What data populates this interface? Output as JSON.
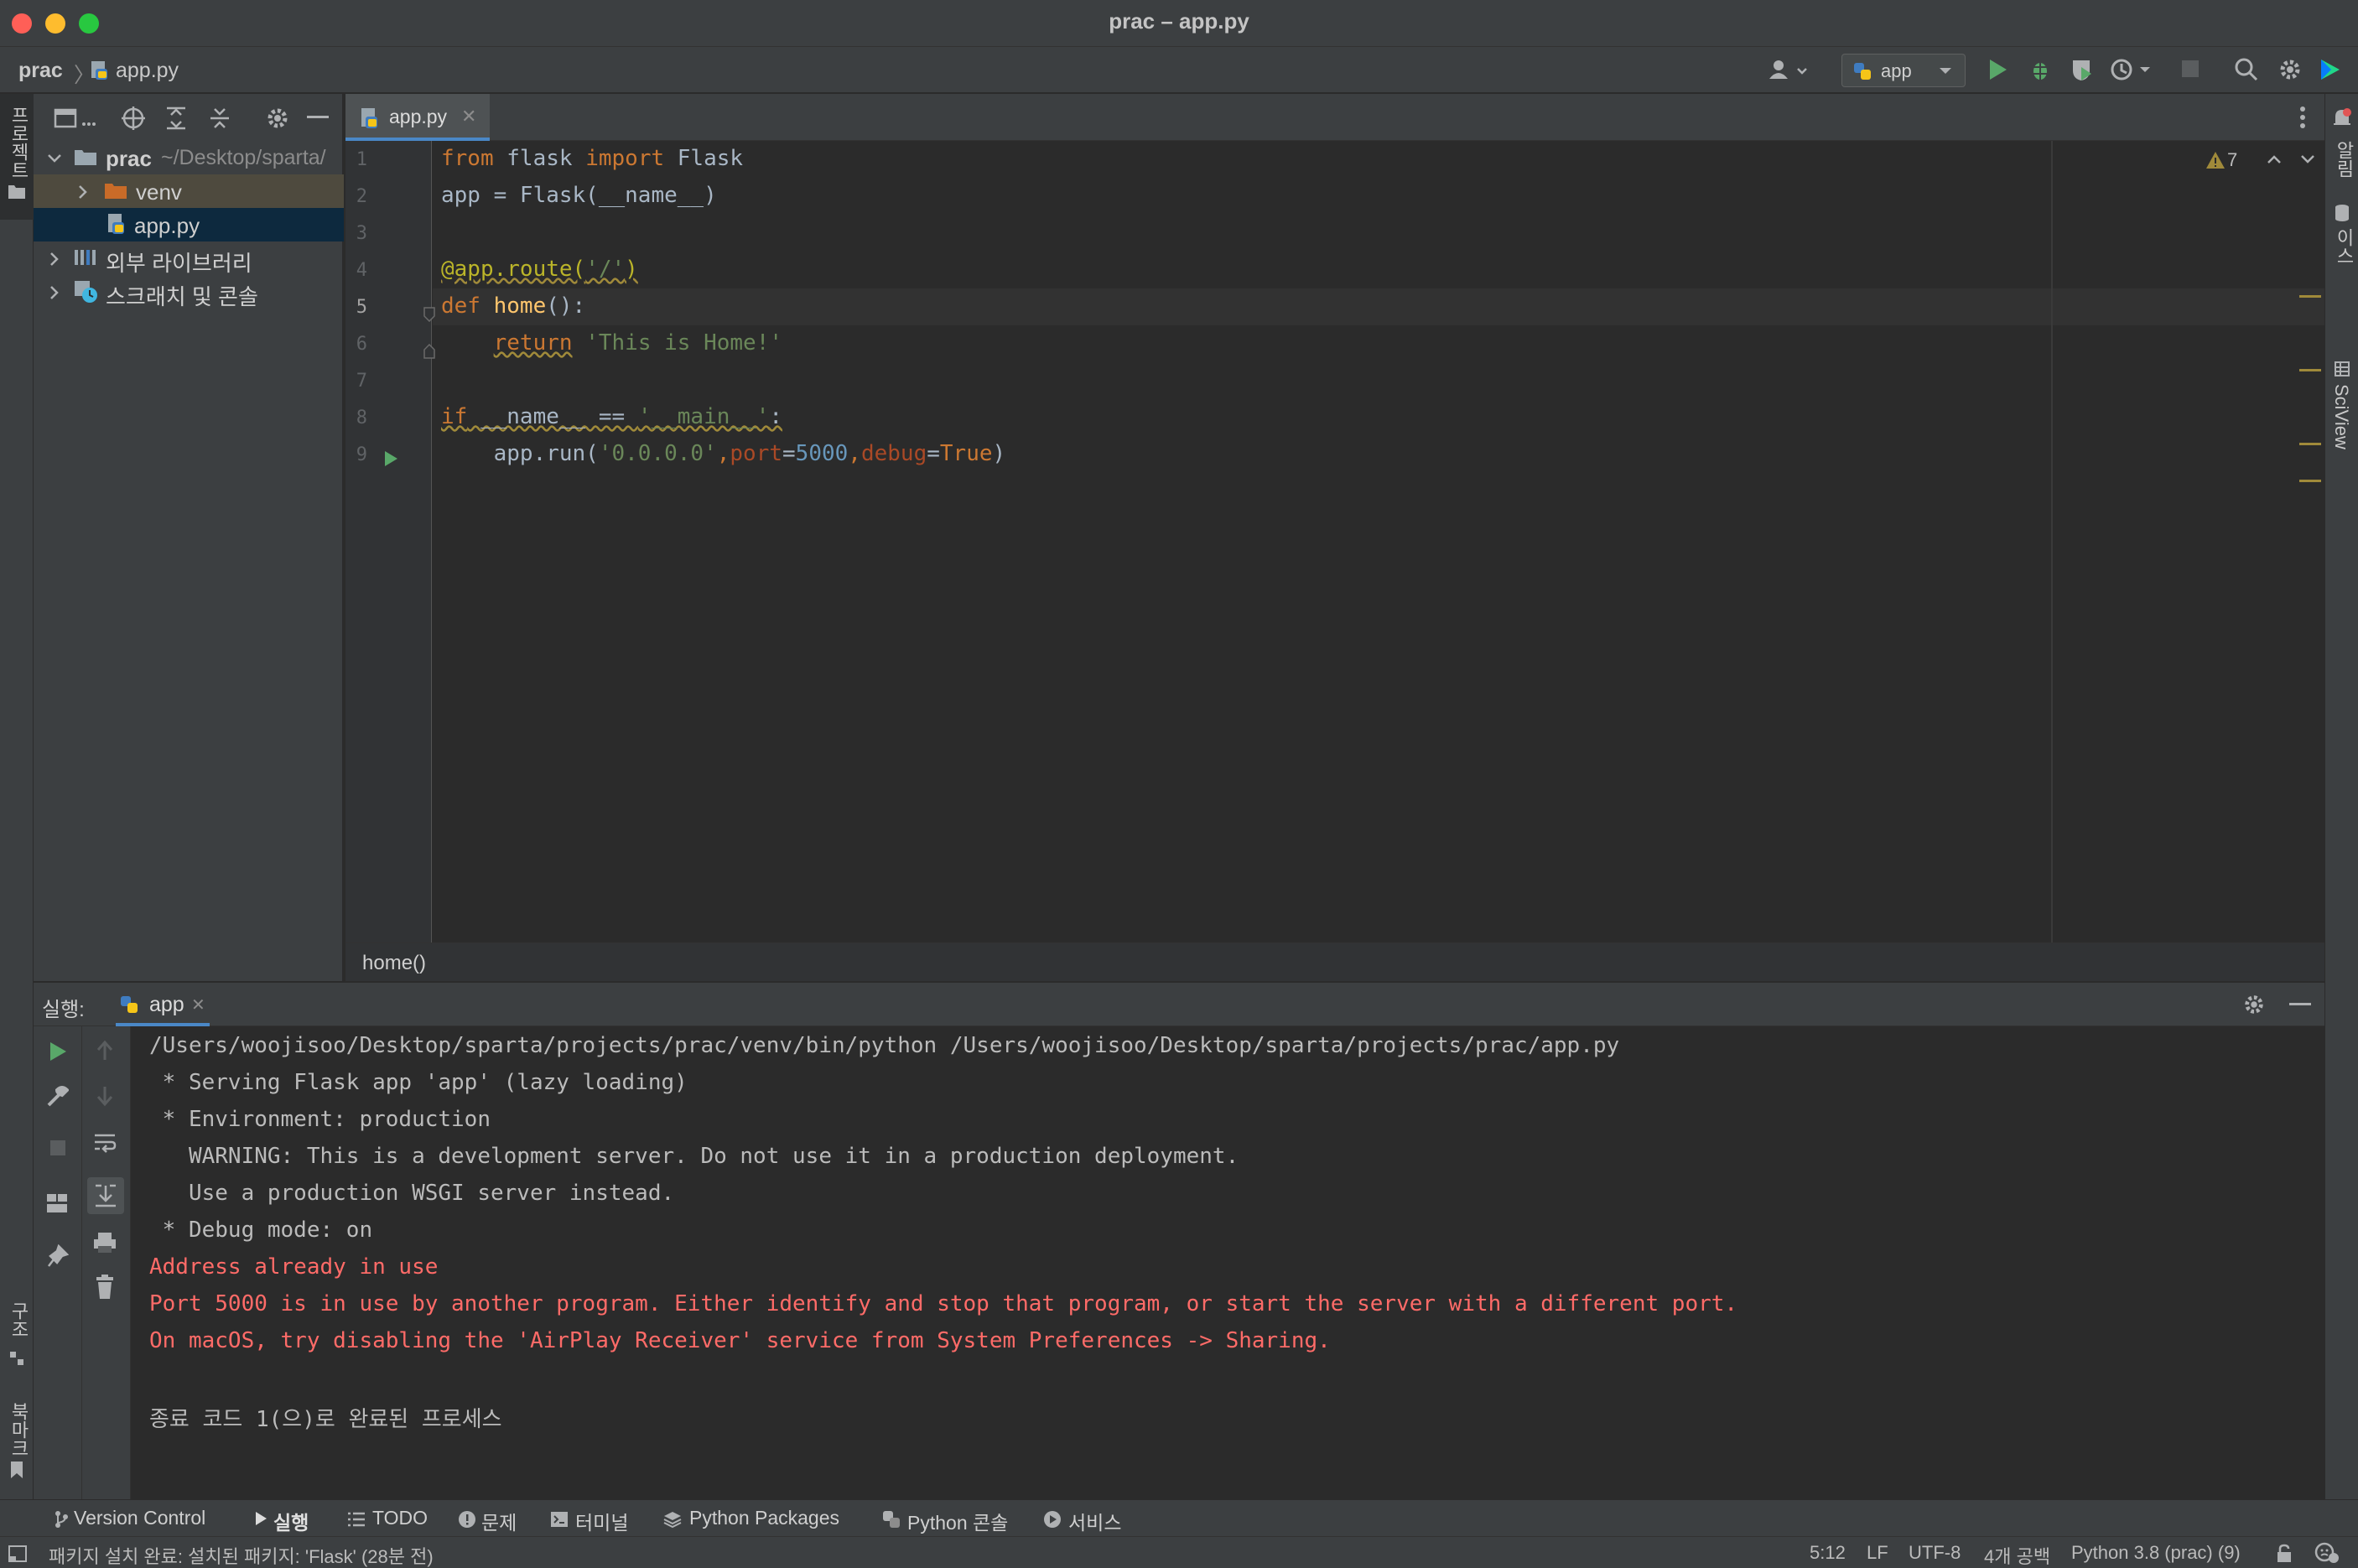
{
  "window": {
    "title": "prac – app.py"
  },
  "navbar": {
    "project": "prac",
    "file": "app.py",
    "run_config": "app"
  },
  "left_strip": {
    "project_label": "프로젝트",
    "structure_label": "구조",
    "bookmarks_label": "북마크"
  },
  "right_strip": {
    "notifications_label": "알림",
    "database_label": "데이터베이스",
    "sciview_label": "SciView"
  },
  "project_tree": {
    "root_name": "prac",
    "root_path": "~/Desktop/sparta/",
    "items": [
      {
        "label": "venv"
      },
      {
        "label": "app.py"
      },
      {
        "label": "외부 라이브러리"
      },
      {
        "label": "스크래치 및 콘솔"
      }
    ]
  },
  "editor": {
    "tab_label": "app.py",
    "warning_count": "7",
    "line_numbers": [
      "1",
      "2",
      "3",
      "4",
      "5",
      "6",
      "7",
      "8",
      "9"
    ],
    "breadcrumb": "home()"
  },
  "run_panel": {
    "label": "실행:",
    "tab_label": "app",
    "output": [
      "/Users/woojisoo/Desktop/sparta/projects/prac/venv/bin/python /Users/woojisoo/Desktop/sparta/projects/prac/app.py",
      " * Serving Flask app 'app' (lazy loading)",
      " * Environment: production",
      "   WARNING: This is a development server. Do not use it in a production deployment.",
      "   Use a production WSGI server instead.",
      " * Debug mode: on",
      "Address already in use",
      "Port 5000 is in use by another program. Either identify and stop that program, or start the server with a different port.",
      "On macOS, try disabling the 'AirPlay Receiver' service from System Preferences -> Sharing.",
      "",
      "종료 코드 1(으)로 완료된 프로세스"
    ]
  },
  "bottom_tabs": [
    "Version Control",
    "실행",
    "TODO",
    "문제",
    "터미널",
    "Python Packages",
    "Python 콘솔",
    "서비스"
  ],
  "status_bar": {
    "message": "패키지 설치 완료: 설치된 패키지: 'Flask' (28분 전)",
    "position": "5:12",
    "line_sep": "LF",
    "encoding": "UTF-8",
    "indent": "4개 공백",
    "interpreter": "Python 3.8 (prac) (9)"
  },
  "colors": {
    "panel_bg": "#3c3f41",
    "editor_bg": "#2b2b2b",
    "keyword": "#cc7832",
    "string": "#6a8759",
    "number": "#6897bb",
    "error": "#ff6b68",
    "run_green": "#59a869"
  }
}
